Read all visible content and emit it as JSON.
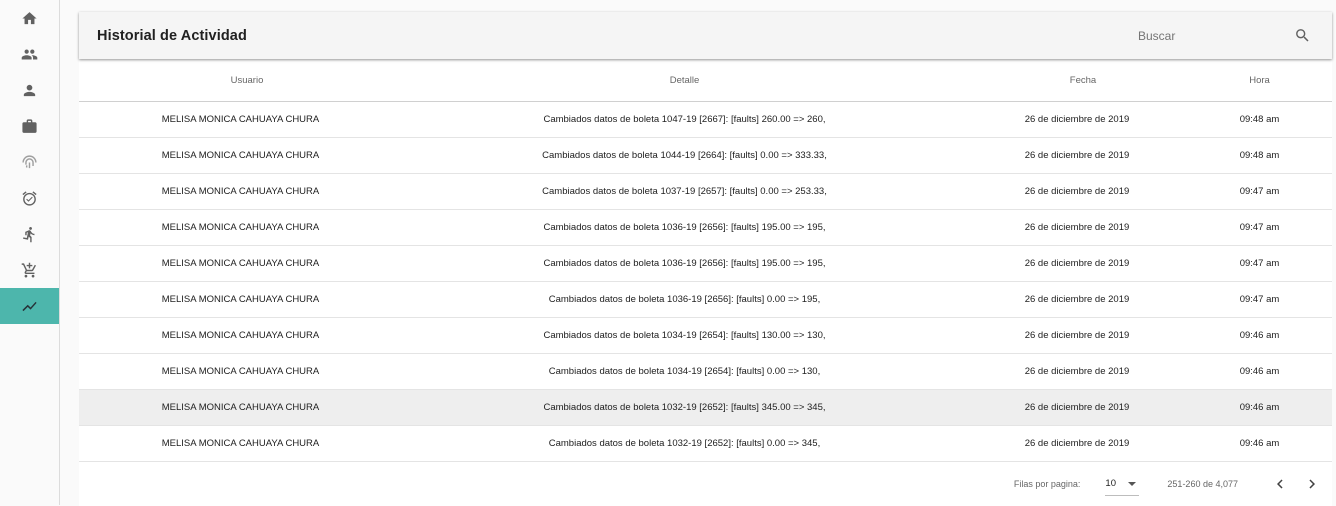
{
  "nav": [
    {
      "icon": "home-icon"
    },
    {
      "icon": "people-icon"
    },
    {
      "icon": "person-icon"
    },
    {
      "icon": "briefcase-icon"
    },
    {
      "icon": "fingerprint-icon"
    },
    {
      "icon": "alarm-icon"
    },
    {
      "icon": "running-person-icon"
    },
    {
      "icon": "add-shopping-cart-icon"
    },
    {
      "icon": "trending-icon",
      "active": true
    }
  ],
  "header": {
    "title": "Historial de Actividad",
    "search_placeholder": "Buscar"
  },
  "table": {
    "columns": [
      "Usuario",
      "Detalle",
      "Fecha",
      "Hora"
    ],
    "rows": [
      {
        "usuario": "MELISA MONICA CAHUAYA CHURA",
        "detalle": "Cambiados datos de boleta 1047-19 [2667]: [faults] 260.00 => 260,",
        "fecha": "26 de diciembre de 2019",
        "hora": "09:48 am"
      },
      {
        "usuario": "MELISA MONICA CAHUAYA CHURA",
        "detalle": "Cambiados datos de boleta 1044-19 [2664]: [faults] 0.00 => 333.33,",
        "fecha": "26 de diciembre de 2019",
        "hora": "09:48 am"
      },
      {
        "usuario": "MELISA MONICA CAHUAYA CHURA",
        "detalle": "Cambiados datos de boleta 1037-19 [2657]: [faults] 0.00 => 253.33,",
        "fecha": "26 de diciembre de 2019",
        "hora": "09:47 am"
      },
      {
        "usuario": "MELISA MONICA CAHUAYA CHURA",
        "detalle": "Cambiados datos de boleta 1036-19 [2656]: [faults] 195.00 => 195,",
        "fecha": "26 de diciembre de 2019",
        "hora": "09:47 am"
      },
      {
        "usuario": "MELISA MONICA CAHUAYA CHURA",
        "detalle": "Cambiados datos de boleta 1036-19 [2656]: [faults] 195.00 => 195,",
        "fecha": "26 de diciembre de 2019",
        "hora": "09:47 am"
      },
      {
        "usuario": "MELISA MONICA CAHUAYA CHURA",
        "detalle": "Cambiados datos de boleta 1036-19 [2656]: [faults] 0.00 => 195,",
        "fecha": "26 de diciembre de 2019",
        "hora": "09:47 am"
      },
      {
        "usuario": "MELISA MONICA CAHUAYA CHURA",
        "detalle": "Cambiados datos de boleta 1034-19 [2654]: [faults] 130.00 => 130,",
        "fecha": "26 de diciembre de 2019",
        "hora": "09:46 am"
      },
      {
        "usuario": "MELISA MONICA CAHUAYA CHURA",
        "detalle": "Cambiados datos de boleta 1034-19 [2654]: [faults] 0.00 => 130,",
        "fecha": "26 de diciembre de 2019",
        "hora": "09:46 am"
      },
      {
        "usuario": "MELISA MONICA CAHUAYA CHURA",
        "detalle": "Cambiados datos de boleta 1032-19 [2652]: [faults] 345.00 => 345,",
        "fecha": "26 de diciembre de 2019",
        "hora": "09:46 am",
        "highlighted": true
      },
      {
        "usuario": "MELISA MONICA CAHUAYA CHURA",
        "detalle": "Cambiados datos de boleta 1032-19 [2652]: [faults] 0.00 => 345,",
        "fecha": "26 de diciembre de 2019",
        "hora": "09:46 am"
      }
    ]
  },
  "pagination": {
    "rows_per_page_label": "Filas por pagina:",
    "rows_per_page": "10",
    "range": "251-260 de 4,077"
  },
  "colors": {
    "active_nav": "#4db6ac",
    "toolbar_bg": "#f5f5f5",
    "highlight_row": "#eeeeee"
  }
}
